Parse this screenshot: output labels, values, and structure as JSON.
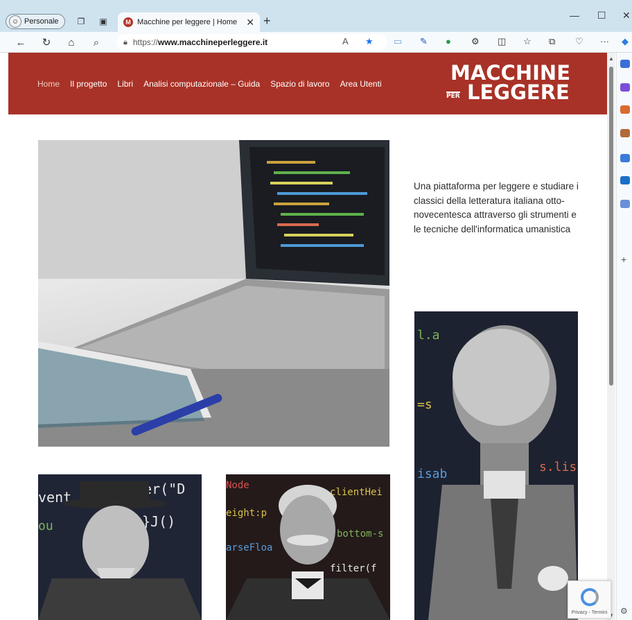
{
  "browser": {
    "profile_label": "Personale",
    "tab_title": "Macchine per leggere | Home",
    "url_scheme": "https://",
    "url_host": "www.macchineperleggere.it",
    "read_aloud_label": "A",
    "new_tab_symbol": "+",
    "tab_close_symbol": "✕",
    "win_minimize": "—",
    "win_maximize": "☐",
    "win_close": "✕",
    "more_symbol": "···"
  },
  "site": {
    "nav": [
      "Home",
      "Il progetto",
      "Libri",
      "Analisi computazionale – Guida",
      "Spazio di lavoro",
      "Area Utenti"
    ],
    "logo_top": "MACCHINE",
    "logo_per": "PER",
    "logo_bottom": "LEGGERE",
    "intro_text": "Una piattaforma per leggere e studiare i classici della letteratura italiana otto-novecentesca attraverso gli strumenti e le tecniche dell'informatica umanistica",
    "recaptcha_text": "Privacy - Termini"
  },
  "colors": {
    "header_bg": "#a83227",
    "tabbar_bg": "#cfe3ef"
  },
  "icons": [
    "back-icon",
    "refresh-icon",
    "home-icon",
    "search-icon",
    "lock-icon",
    "star-icon",
    "collections-icon",
    "copilot-icon",
    "settings-icon"
  ]
}
